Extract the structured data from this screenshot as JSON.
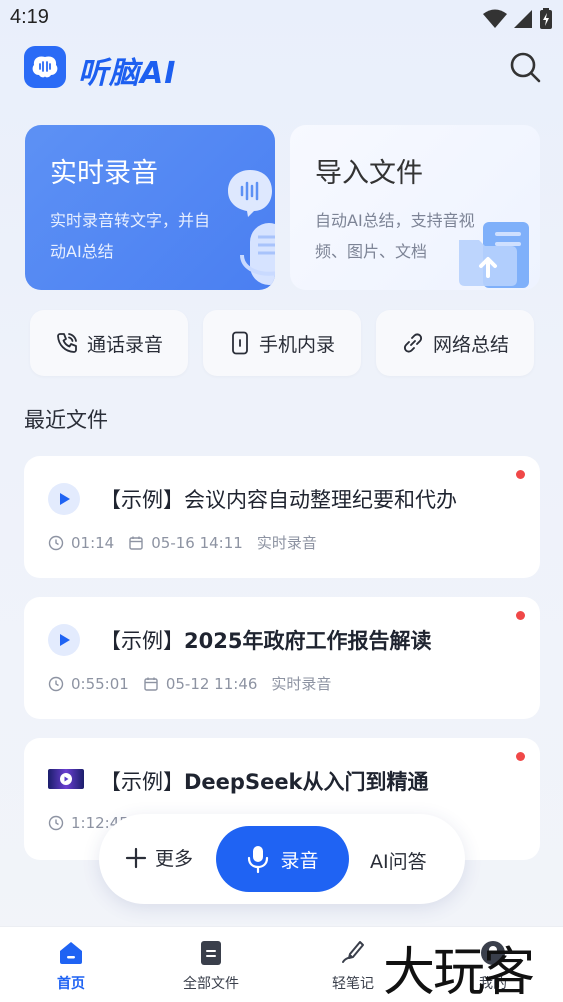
{
  "status": {
    "time": "4:19"
  },
  "app": {
    "name": "听脑AI"
  },
  "cards": {
    "record": {
      "title": "实时录音",
      "desc": "实时录音转文字，并自动AI总结"
    },
    "import": {
      "title": "导入文件",
      "desc": "自动AI总结，支持音视频、图片、文档"
    }
  },
  "quick_actions": [
    {
      "label": "通话录音",
      "icon": "phone-icon"
    },
    {
      "label": "手机内录",
      "icon": "mobile-icon"
    },
    {
      "label": "网络总结",
      "icon": "link-icon"
    }
  ],
  "recent": {
    "title": "最近文件",
    "files": [
      {
        "title_prefix": "【示例】",
        "title": "会议内容自动整理纪要和代办",
        "duration": "01:14",
        "date": "05-16 14:11",
        "source": "实时录音"
      },
      {
        "title_prefix": "【示例】",
        "title": "2025年政府工作报告解读",
        "duration": "0:55:01",
        "date": "05-12 11:46",
        "source": "实时录音"
      },
      {
        "title_prefix": "【示例】",
        "title": "DeepSeek从入门到精通",
        "duration": "1:12:45"
      }
    ]
  },
  "float_bar": {
    "more": "更多",
    "record": "录音",
    "ai": "AI问答"
  },
  "tabs": [
    {
      "label": "首页",
      "active": true
    },
    {
      "label": "全部文件"
    },
    {
      "label": "轻笔记"
    },
    {
      "label": "我的"
    }
  ],
  "watermark": "大玩客",
  "colors": {
    "accent": "#1f63f3",
    "dot": "#f04848"
  }
}
